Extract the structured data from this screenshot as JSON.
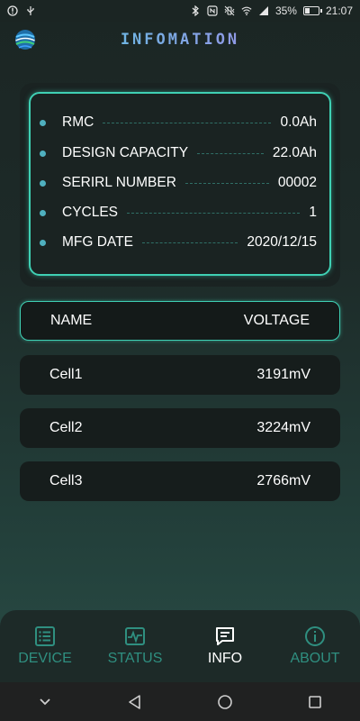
{
  "status_bar": {
    "battery_percent": "35%",
    "battery_level": 0.35,
    "time": "21:07"
  },
  "header": {
    "title": "INFOMATION"
  },
  "info_card": {
    "rows": [
      {
        "label": "RMC",
        "value": "0.0Ah"
      },
      {
        "label": "DESIGN CAPACITY",
        "value": "22.0Ah"
      },
      {
        "label": "SERIRL NUMBER",
        "value": "00002"
      },
      {
        "label": "CYCLES",
        "value": "1"
      },
      {
        "label": "MFG DATE",
        "value": "2020/12/15"
      }
    ]
  },
  "cell_table": {
    "headers": {
      "name": "NAME",
      "voltage": "VOLTAGE"
    },
    "rows": [
      {
        "name": "Cell1",
        "voltage": "3191mV"
      },
      {
        "name": "Cell2",
        "voltage": "3224mV"
      },
      {
        "name": "Cell3",
        "voltage": "2766mV"
      }
    ]
  },
  "bottom_nav": {
    "items": [
      {
        "label": "DEVICE",
        "icon": "list-icon",
        "active": false
      },
      {
        "label": "STATUS",
        "icon": "pulse-icon",
        "active": false
      },
      {
        "label": "INFO",
        "icon": "message-icon",
        "active": true
      },
      {
        "label": "ABOUT",
        "icon": "info-icon",
        "active": false
      }
    ]
  },
  "colors": {
    "accent": "#3fd0b4",
    "inactive_nav": "#2f8f80",
    "background": "#1d2a28"
  }
}
